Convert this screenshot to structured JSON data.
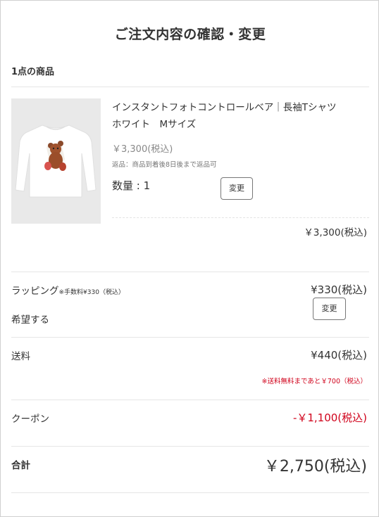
{
  "page": {
    "title": "ご注文内容の確認・変更"
  },
  "cart": {
    "count_heading": "1点の商品"
  },
  "item": {
    "name_line1": "インスタントフォトコントロールベア｜長袖Tシャツ",
    "name_line2": "ホワイト　Mサイズ",
    "unit_price": "￥3,300(税込)",
    "return_note": "返品：商品到着後8日後まで返品可",
    "quantity": "数量 : 1",
    "change_label": "変更",
    "line_total": "￥3,300(税込)",
    "image_icon": "tshirt-image"
  },
  "wrapping": {
    "label": "ラッピング",
    "fee_note": "※手数料¥330（税込）",
    "choice": "希望する",
    "price": "¥330(税込)",
    "change_label": "変更"
  },
  "shipping": {
    "label": "送料",
    "price": "¥440(税込)",
    "free_note": "※送料無料まであと￥700（税込）"
  },
  "coupon": {
    "label": "クーポン",
    "discount": "-￥1,100(税込)"
  },
  "total": {
    "label": "合計",
    "amount": "￥2,750(税込)"
  },
  "colors": {
    "text": "#333333",
    "muted": "#888888",
    "accent_red": "#d0021b",
    "divider": "#e6e6e6"
  }
}
